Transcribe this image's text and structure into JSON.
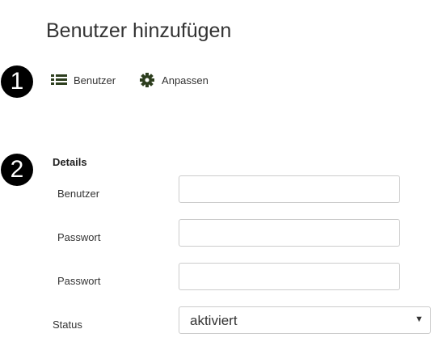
{
  "page": {
    "title": "Benutzer hinzufügen"
  },
  "steps": {
    "one": "1",
    "two": "2"
  },
  "toolbar": {
    "users_label": "Benutzer",
    "users_icon": "list-icon",
    "customize_label": "Anpassen",
    "customize_icon": "gear-icon",
    "icon_color": "#2d3e1e"
  },
  "form": {
    "section_title": "Details",
    "username_label": "Benutzer",
    "username_value": "",
    "password_label": "Passwort",
    "password_value": "",
    "password_confirm_label": "Passwort",
    "password_confirm_value": "",
    "status_label": "Status",
    "status_value": "aktiviert"
  }
}
